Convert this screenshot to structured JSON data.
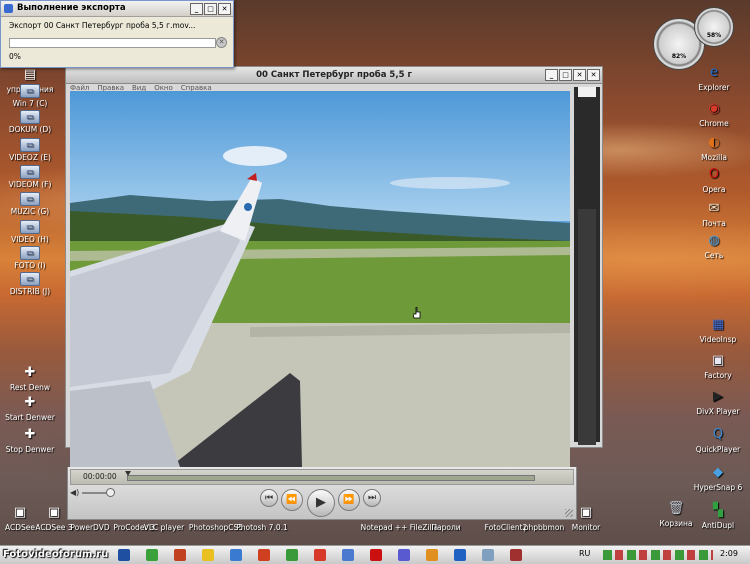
{
  "export_dialog": {
    "title": "Выполнение экспорта",
    "message": "Экспорт 00 Санкт Петербург проба 5,5 г.mov...",
    "percent_text": "0%",
    "progress": 0.0,
    "buttons": [
      "_",
      "□",
      "✕"
    ]
  },
  "gauges": {
    "cpu": "82%",
    "mem": "58%"
  },
  "left_icons": [
    {
      "label": "управления",
      "glyph": "▤"
    },
    {
      "label": "Win 7 (C)",
      "glyph": "▭"
    },
    {
      "label": "DOKUM (D)",
      "glyph": "▭"
    },
    {
      "label": "VIDEOZ (E)",
      "glyph": "▭"
    },
    {
      "label": "VIDEOM (F)",
      "glyph": "▭"
    },
    {
      "label": "MUZIC (G)",
      "glyph": "▭"
    },
    {
      "label": "VIDEO (H)",
      "glyph": "▭"
    },
    {
      "label": "FOTO (I)",
      "glyph": "▭"
    },
    {
      "label": "DISTRIB (J)",
      "glyph": "▭"
    },
    {
      "label": "Rest Denw",
      "glyph": "✚"
    },
    {
      "label": "Start Denwer",
      "glyph": "✚"
    },
    {
      "label": "Stop Denwer",
      "glyph": "✚"
    }
  ],
  "right_icons": [
    {
      "label": "Explorer",
      "glyph": "e",
      "color": "#1e6fd0"
    },
    {
      "label": "Chrome",
      "glyph": "◉",
      "color": "#d83a2a"
    },
    {
      "label": "Mozilla",
      "glyph": "◐",
      "color": "#e0701a"
    },
    {
      "label": "Opera",
      "glyph": "O",
      "color": "#cc1010"
    },
    {
      "label": "Почта",
      "glyph": "✉",
      "color": "#e8e0c8"
    },
    {
      "label": "Сеть",
      "glyph": "◍",
      "color": "#4aa0e0"
    },
    {
      "label": "VideoInsp",
      "glyph": "▦",
      "color": "#3a6ad0"
    },
    {
      "label": "Factory",
      "glyph": "▣",
      "color": "#e8e8f4"
    },
    {
      "label": "DivX Player",
      "glyph": "▶",
      "color": "#222222"
    },
    {
      "label": "QuickPlayer",
      "glyph": "Q",
      "color": "#3a8ad8"
    },
    {
      "label": "HyperSnap 6",
      "glyph": "◆",
      "color": "#4aa0e0"
    },
    {
      "label": "Корзина",
      "glyph": "🗑",
      "color": "#c0c8d0"
    },
    {
      "label": "AntiDupl",
      "glyph": "▚",
      "color": "#30a040"
    }
  ],
  "bottom_icons": [
    {
      "label": "ACDSee"
    },
    {
      "label": "ACDSee 3"
    },
    {
      "label": "PowerDVD"
    },
    {
      "label": "ProCoder 3"
    },
    {
      "label": "VLC player"
    },
    {
      "label": "PhotoshopCS5"
    },
    {
      "label": "Photosh 7.0.1"
    },
    {
      "label": "Notepad ++"
    },
    {
      "label": "FileZilla"
    },
    {
      "label": "Пароли"
    },
    {
      "label": "FotoClient2"
    },
    {
      "label": "phpbbmon"
    },
    {
      "label": "Monitor"
    }
  ],
  "player": {
    "title": "00 Санкт Петербург проба 5,5 г",
    "menu": [
      "Файл",
      "Правка",
      "Вид",
      "Окно",
      "Справка"
    ],
    "time": "00:00:00",
    "position": 0.0,
    "volume": 0.85,
    "buttons": [
      "⏮",
      "⏪",
      "▶",
      "⏩",
      "⏭"
    ]
  },
  "taskbar": {
    "lang": "RU",
    "clock": "2:09"
  },
  "watermark": "Fotovideoforum.ru"
}
